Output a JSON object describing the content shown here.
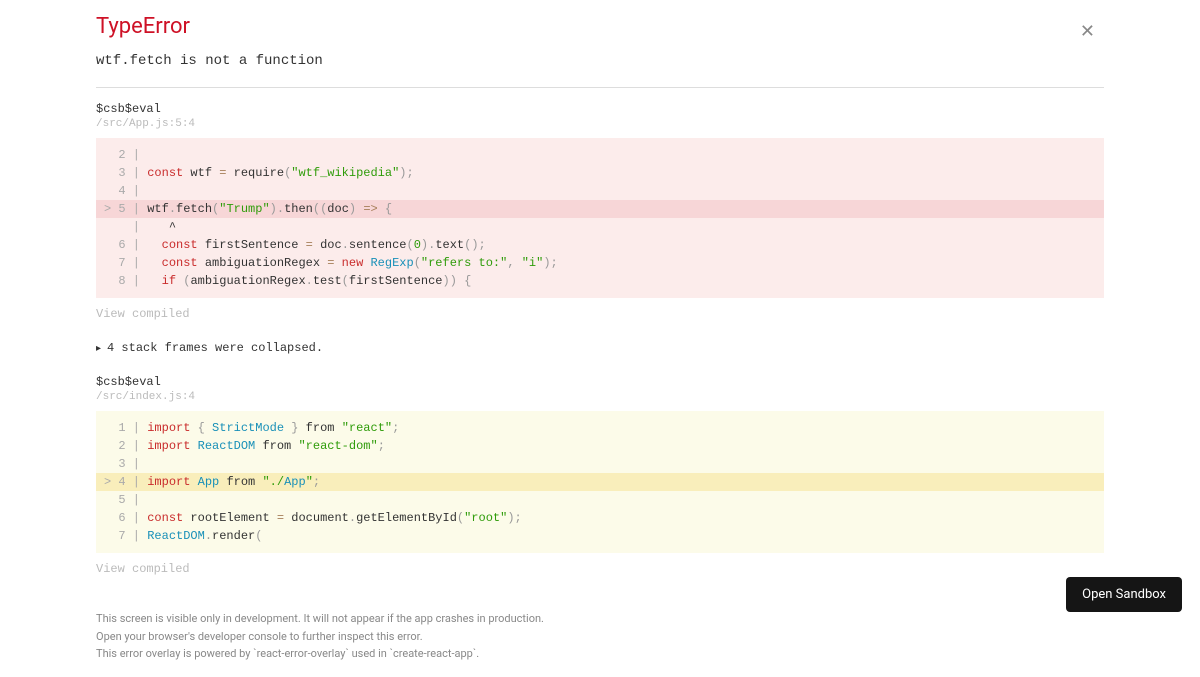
{
  "error": {
    "type": "TypeError",
    "message": "wtf.fetch is not a function"
  },
  "frames": [
    {
      "label": "$csb$eval",
      "location": "/src/App.js:5:4",
      "style": "red",
      "highlight_index": 3,
      "lines": [
        {
          "gutter": "  2 | ",
          "tokens": []
        },
        {
          "gutter": "  3 | ",
          "tokens": [
            {
              "t": "keyword",
              "v": "const"
            },
            {
              "t": "plain",
              "v": " wtf "
            },
            {
              "t": "operator",
              "v": "="
            },
            {
              "t": "plain",
              "v": " require"
            },
            {
              "t": "punct",
              "v": "("
            },
            {
              "t": "string",
              "v": "\"wtf_wikipedia\""
            },
            {
              "t": "punct",
              "v": ")"
            },
            {
              "t": "punct",
              "v": ";"
            }
          ]
        },
        {
          "gutter": "  4 | ",
          "tokens": []
        },
        {
          "gutter": "> 5 | ",
          "tokens": [
            {
              "t": "plain",
              "v": "wtf"
            },
            {
              "t": "punct",
              "v": "."
            },
            {
              "t": "plain",
              "v": "fetch"
            },
            {
              "t": "punct",
              "v": "("
            },
            {
              "t": "string",
              "v": "\"Trump\""
            },
            {
              "t": "punct",
              "v": ")"
            },
            {
              "t": "punct",
              "v": "."
            },
            {
              "t": "plain",
              "v": "then"
            },
            {
              "t": "punct",
              "v": "("
            },
            {
              "t": "punct",
              "v": "("
            },
            {
              "t": "plain",
              "v": "doc"
            },
            {
              "t": "punct",
              "v": ")"
            },
            {
              "t": "plain",
              "v": " "
            },
            {
              "t": "arrow",
              "v": "=>"
            },
            {
              "t": "plain",
              "v": " "
            },
            {
              "t": "punct",
              "v": "{"
            }
          ]
        },
        {
          "gutter": "    | ",
          "tokens": [
            {
              "t": "plain",
              "v": "   ^"
            }
          ]
        },
        {
          "gutter": "  6 | ",
          "tokens": [
            {
              "t": "plain",
              "v": "  "
            },
            {
              "t": "keyword",
              "v": "const"
            },
            {
              "t": "plain",
              "v": " firstSentence "
            },
            {
              "t": "operator",
              "v": "="
            },
            {
              "t": "plain",
              "v": " doc"
            },
            {
              "t": "punct",
              "v": "."
            },
            {
              "t": "plain",
              "v": "sentence"
            },
            {
              "t": "punct",
              "v": "("
            },
            {
              "t": "number",
              "v": "0"
            },
            {
              "t": "punct",
              "v": ")"
            },
            {
              "t": "punct",
              "v": "."
            },
            {
              "t": "plain",
              "v": "text"
            },
            {
              "t": "punct",
              "v": "("
            },
            {
              "t": "punct",
              "v": ")"
            },
            {
              "t": "punct",
              "v": ";"
            }
          ]
        },
        {
          "gutter": "  7 | ",
          "tokens": [
            {
              "t": "plain",
              "v": "  "
            },
            {
              "t": "keyword",
              "v": "const"
            },
            {
              "t": "plain",
              "v": " ambiguationRegex "
            },
            {
              "t": "operator",
              "v": "="
            },
            {
              "t": "plain",
              "v": " "
            },
            {
              "t": "keyword",
              "v": "new"
            },
            {
              "t": "plain",
              "v": " "
            },
            {
              "t": "class",
              "v": "RegExp"
            },
            {
              "t": "punct",
              "v": "("
            },
            {
              "t": "string",
              "v": "\"refers to:\""
            },
            {
              "t": "punct",
              "v": ","
            },
            {
              "t": "plain",
              "v": " "
            },
            {
              "t": "string",
              "v": "\"i\""
            },
            {
              "t": "punct",
              "v": ")"
            },
            {
              "t": "punct",
              "v": ";"
            }
          ]
        },
        {
          "gutter": "  8 | ",
          "tokens": [
            {
              "t": "plain",
              "v": "  "
            },
            {
              "t": "keyword",
              "v": "if"
            },
            {
              "t": "plain",
              "v": " "
            },
            {
              "t": "punct",
              "v": "("
            },
            {
              "t": "plain",
              "v": "ambiguationRegex"
            },
            {
              "t": "punct",
              "v": "."
            },
            {
              "t": "plain",
              "v": "test"
            },
            {
              "t": "punct",
              "v": "("
            },
            {
              "t": "plain",
              "v": "firstSentence"
            },
            {
              "t": "punct",
              "v": ")"
            },
            {
              "t": "punct",
              "v": ")"
            },
            {
              "t": "plain",
              "v": " "
            },
            {
              "t": "punct",
              "v": "{"
            }
          ]
        }
      ]
    },
    {
      "label": "$csb$eval",
      "location": "/src/index.js:4",
      "style": "yellow",
      "highlight_index": 3,
      "lines": [
        {
          "gutter": "  1 | ",
          "tokens": [
            {
              "t": "keyword",
              "v": "import"
            },
            {
              "t": "plain",
              "v": " "
            },
            {
              "t": "punct",
              "v": "{"
            },
            {
              "t": "plain",
              "v": " "
            },
            {
              "t": "class",
              "v": "StrictMode"
            },
            {
              "t": "plain",
              "v": " "
            },
            {
              "t": "punct",
              "v": "}"
            },
            {
              "t": "plain",
              "v": " from "
            },
            {
              "t": "string",
              "v": "\"react\""
            },
            {
              "t": "punct",
              "v": ";"
            }
          ]
        },
        {
          "gutter": "  2 | ",
          "tokens": [
            {
              "t": "keyword",
              "v": "import"
            },
            {
              "t": "plain",
              "v": " "
            },
            {
              "t": "class",
              "v": "ReactDOM"
            },
            {
              "t": "plain",
              "v": " from "
            },
            {
              "t": "string",
              "v": "\"react-dom\""
            },
            {
              "t": "punct",
              "v": ";"
            }
          ]
        },
        {
          "gutter": "  3 | ",
          "tokens": []
        },
        {
          "gutter": "> 4 | ",
          "tokens": [
            {
              "t": "keyword",
              "v": "import"
            },
            {
              "t": "plain",
              "v": " "
            },
            {
              "t": "class",
              "v": "App"
            },
            {
              "t": "plain",
              "v": " from "
            },
            {
              "t": "string",
              "v": "\"./"
            },
            {
              "t": "class",
              "v": "App"
            },
            {
              "t": "string",
              "v": "\""
            },
            {
              "t": "punct",
              "v": ";"
            }
          ]
        },
        {
          "gutter": "  5 | ",
          "tokens": []
        },
        {
          "gutter": "  6 | ",
          "tokens": [
            {
              "t": "keyword",
              "v": "const"
            },
            {
              "t": "plain",
              "v": " rootElement "
            },
            {
              "t": "operator",
              "v": "="
            },
            {
              "t": "plain",
              "v": " document"
            },
            {
              "t": "punct",
              "v": "."
            },
            {
              "t": "plain",
              "v": "getElementById"
            },
            {
              "t": "punct",
              "v": "("
            },
            {
              "t": "string",
              "v": "\"root\""
            },
            {
              "t": "punct",
              "v": ")"
            },
            {
              "t": "punct",
              "v": ";"
            }
          ]
        },
        {
          "gutter": "  7 | ",
          "tokens": [
            {
              "t": "class",
              "v": "ReactDOM"
            },
            {
              "t": "punct",
              "v": "."
            },
            {
              "t": "plain",
              "v": "render"
            },
            {
              "t": "punct",
              "v": "("
            }
          ]
        }
      ]
    }
  ],
  "view_compiled_label": "View compiled",
  "collapsed_frames_label": "4 stack frames were collapsed.",
  "footer": {
    "line1": "This screen is visible only in development. It will not appear if the app crashes in production.",
    "line2": "Open your browser's developer console to further inspect this error.",
    "line3": "This error overlay is powered by `react-error-overlay` used in `create-react-app`."
  },
  "open_sandbox_label": "Open Sandbox"
}
